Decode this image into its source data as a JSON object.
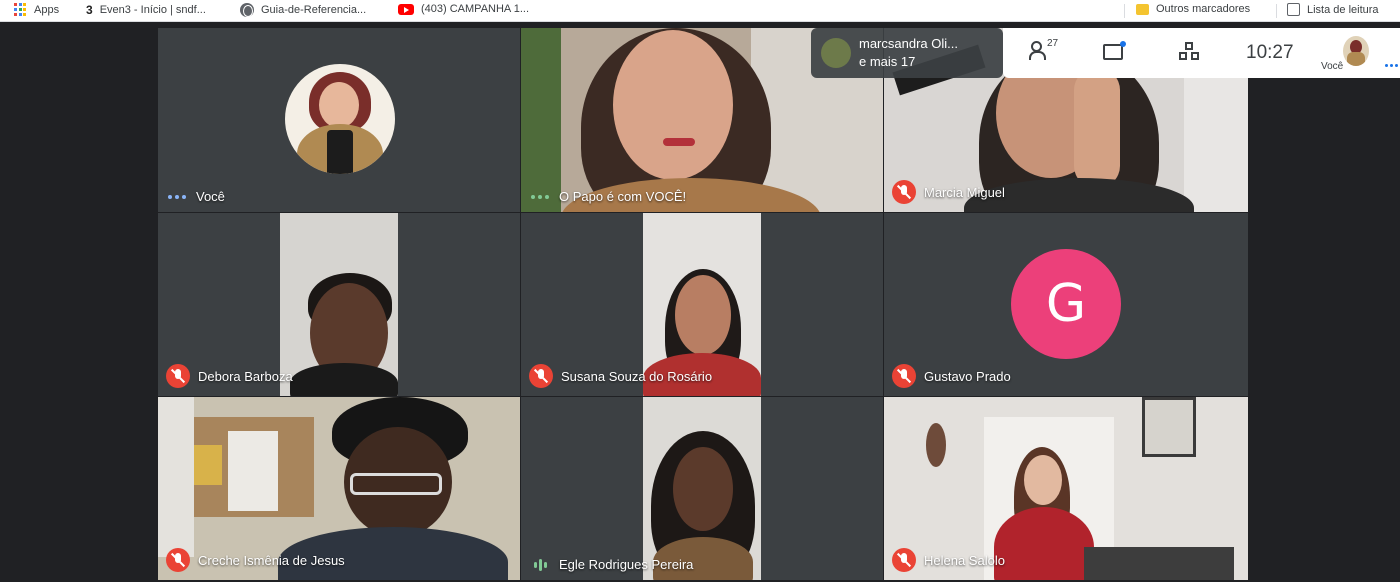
{
  "bookmarks": {
    "items": [
      {
        "label": "Apps",
        "icon": "apps-grid-icon"
      },
      {
        "label": "Even3 - Início | sndf...",
        "icon": "even3-icon"
      },
      {
        "label": "Guia-de-Referencia...",
        "icon": "globe-icon"
      },
      {
        "label": "(403) CAMPANHA 1...",
        "icon": "youtube-icon"
      }
    ],
    "other_bookmarks": "Outros marcadores",
    "reading_list": "Lista de leitura"
  },
  "meeting": {
    "raised_hand": {
      "name": "marcsandra Oli...",
      "more": "e mais 17"
    },
    "participants_count": "27",
    "time": "10:27",
    "self_label": "Você"
  },
  "tiles": [
    {
      "name": "Você",
      "status": "speaking-dots",
      "bg": "#3c4043"
    },
    {
      "name": "O Papo é com VOCÊ!",
      "status": "speaking-dots",
      "bg": "#b7a999"
    },
    {
      "name": "Marcia Miguel",
      "status": "muted",
      "bg": "#d9d6d3"
    },
    {
      "name": "Debora Barboza",
      "status": "muted",
      "bg": "#3c4043"
    },
    {
      "name": "Susana Souza do Rosário",
      "status": "muted",
      "bg": "#3c4043"
    },
    {
      "name": "Gustavo Prado",
      "status": "muted",
      "bg": "#3c4043",
      "avatar_letter": "G",
      "avatar_color": "#ec407a"
    },
    {
      "name": "Creche Ismênia de Jesus",
      "status": "muted",
      "bg": "#c9c2b1"
    },
    {
      "name": "Egle Rodrigues Pereira",
      "status": "audio-bars",
      "bg": "#3c4043"
    },
    {
      "name": "Helena Salolo",
      "status": "muted",
      "bg": "#e3e0dc"
    }
  ]
}
